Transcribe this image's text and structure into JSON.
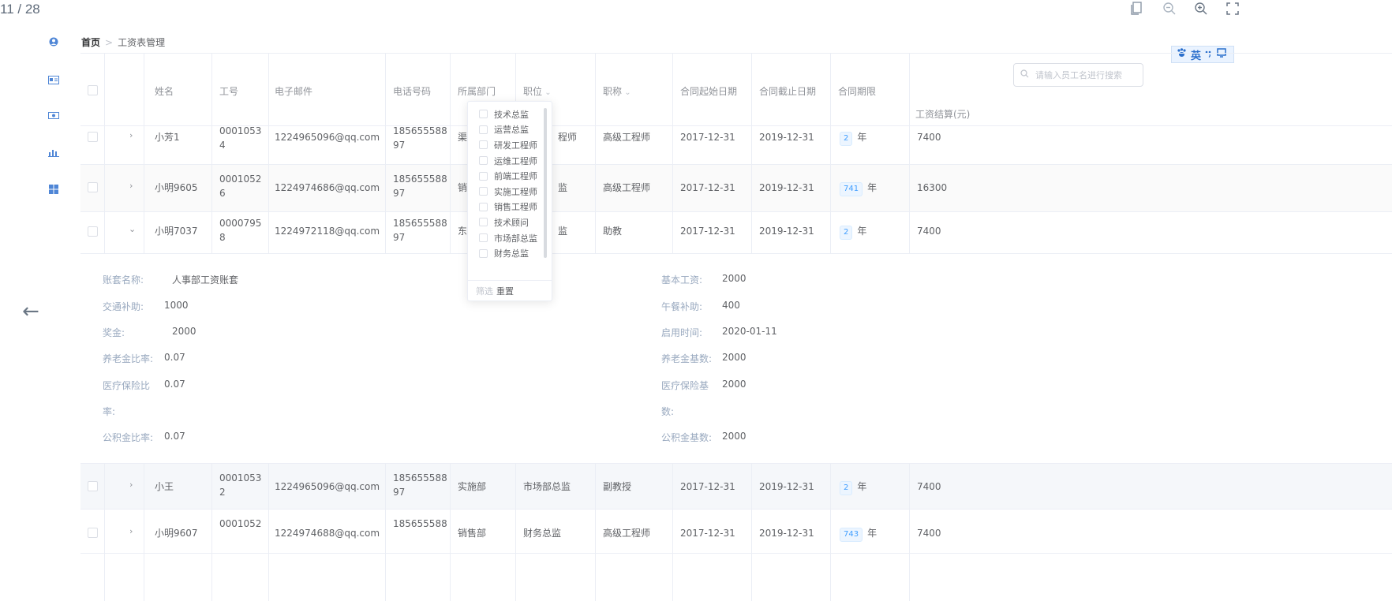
{
  "viewer": {
    "page_counter": "11 / 28",
    "icons": [
      "copy-icon",
      "zoom-out-icon",
      "zoom-in-icon",
      "fullscreen-icon"
    ]
  },
  "breadcrumb": {
    "home": "首页",
    "separator": ">",
    "current": "工资表管理"
  },
  "ime": {
    "label": "英"
  },
  "search": {
    "placeholder": "请输入员工名进行搜索"
  },
  "table": {
    "headers": {
      "name": "姓名",
      "id": "工号",
      "email": "电子邮件",
      "phone": "电话号码",
      "dept": "所属部门",
      "position": "职位",
      "title": "职称",
      "start": "合同起始日期",
      "end": "合同截止日期",
      "term": "合同期限",
      "salary": "工资结算(元)"
    },
    "rows": [
      {
        "name": "小芳1",
        "id1": "0001053",
        "id2": "4",
        "email": "1224965096@qq.com",
        "phone1": "185655588",
        "phone2": "97",
        "dept": "渠",
        "position": "程师",
        "title": "高级工程师",
        "start": "2017-12-31",
        "end": "2019-12-31",
        "term": "2",
        "unit": "年",
        "salary": "7400",
        "expand": "›"
      },
      {
        "name": "小明9605",
        "id1": "0001052",
        "id2": "6",
        "email": "1224974686@qq.com",
        "phone1": "185655588",
        "phone2": "97",
        "dept": "销",
        "position": "监",
        "title": "高级工程师",
        "start": "2017-12-31",
        "end": "2019-12-31",
        "term": "741",
        "unit": "年",
        "salary": "16300",
        "expand": "›"
      },
      {
        "name": "小明7037",
        "id1": "0000795",
        "id2": "8",
        "email": "1224972118@qq.com",
        "phone1": "185655588",
        "phone2": "97",
        "dept": "东",
        "position": "监",
        "title": "助教",
        "start": "2017-12-31",
        "end": "2019-12-31",
        "term": "2",
        "unit": "年",
        "salary": "7400",
        "expand": "⌄"
      },
      {
        "name": "小王",
        "id1": "0001053",
        "id2": "2",
        "email": "1224965096@qq.com",
        "phone1": "185655588",
        "phone2": "97",
        "dept": "实施部",
        "position": "市场部总监",
        "title": "副教授",
        "start": "2017-12-31",
        "end": "2019-12-31",
        "term": "2",
        "unit": "年",
        "salary": "7400",
        "expand": "›"
      },
      {
        "name": "小明9607",
        "id1": "0001052",
        "id2": "",
        "email": "1224974688@qq.com",
        "phone1": "185655588",
        "phone2": "",
        "dept": "销售部",
        "position": "财务总监",
        "title": "高级工程师",
        "start": "2017-12-31",
        "end": "2019-12-31",
        "term": "743",
        "unit": "年",
        "salary": "7400",
        "expand": "›"
      }
    ]
  },
  "detail": {
    "left": [
      {
        "label": "账套名称:",
        "value": "人事部工资账套"
      },
      {
        "label": "交通补助:",
        "value": "1000"
      },
      {
        "label": "奖金:",
        "value": "2000"
      },
      {
        "label": "养老金比率:",
        "value": "0.07"
      },
      {
        "label": "医疗保险比",
        "label2": "率:",
        "value": "0.07"
      },
      {
        "label": "公积金比率:",
        "value": "0.07"
      }
    ],
    "right": [
      {
        "label": "基本工资:",
        "value": "2000"
      },
      {
        "label": "午餐补助:",
        "value": "400"
      },
      {
        "label": "启用时间:",
        "value": "2020-01-11"
      },
      {
        "label": "养老金基数:",
        "value": "2000"
      },
      {
        "label": "医疗保险基",
        "label2": "数:",
        "value": "2000"
      },
      {
        "label": "公积金基数:",
        "value": "2000"
      }
    ]
  },
  "filter": {
    "options": [
      "技术总监",
      "运营总监",
      "研发工程师",
      "运维工程师",
      "前端工程师",
      "实施工程师",
      "销售工程师",
      "技术顾问",
      "市场部总监",
      "财务总监"
    ],
    "confirm": "筛选",
    "reset": "重置"
  }
}
